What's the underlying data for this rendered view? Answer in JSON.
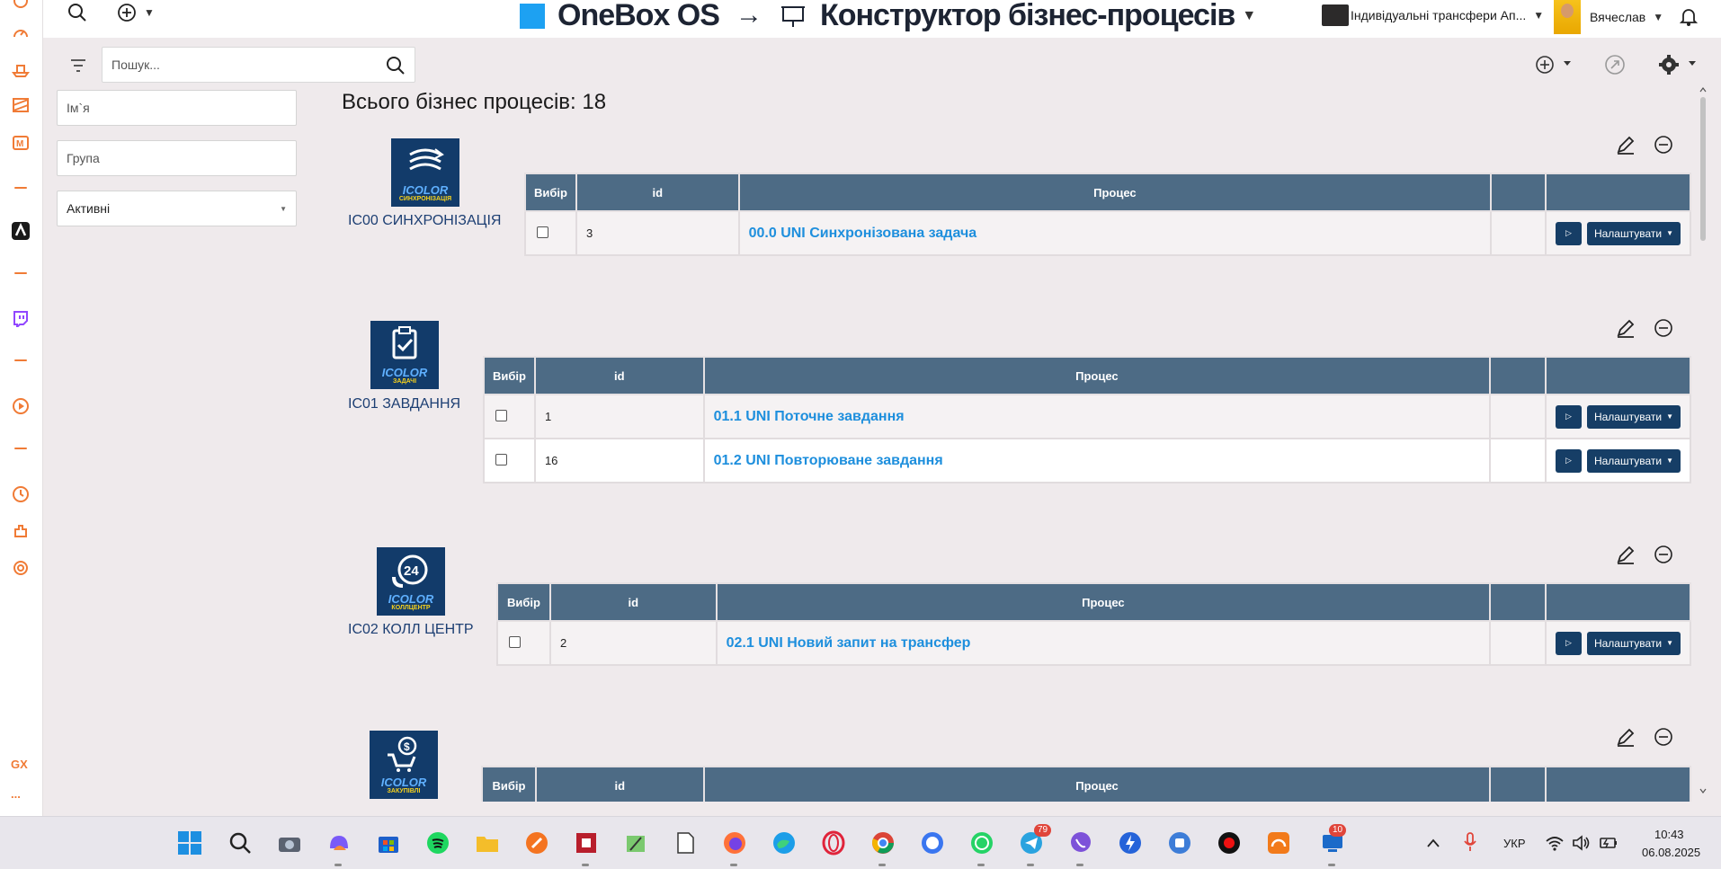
{
  "browser_sidebar": {
    "icons": [
      "home-icon",
      "speed-dial-icon",
      "boat-icon",
      "film-icon",
      "mail-icon",
      "app-icon",
      "twitch-icon",
      "player-icon",
      "history-icon",
      "extensions-icon",
      "settings-icon"
    ],
    "footer_label": "GX",
    "more_label": "..."
  },
  "header": {
    "brand": "OneBox OS",
    "arrow": "→",
    "title": "Конструктор бізнес-процесів",
    "company": "Індивідуальні трансфери Ап...",
    "user": "Вячеслав"
  },
  "toolbar": {
    "search_placeholder": "Пошук..."
  },
  "filters": {
    "name_placeholder": "Ім`я",
    "group_placeholder": "Група",
    "status_value": "Активні"
  },
  "summary": {
    "total": "Всього бізнес процесів: 18"
  },
  "table_headers": {
    "select": "Вибір",
    "id": "id",
    "process": "Процес"
  },
  "buttons": {
    "run": "▷",
    "configure": "Налаштувати"
  },
  "groups": [
    {
      "name": "IC00 СИНХРОНІЗАЦІЯ",
      "logo_brand": "ICOLOR",
      "logo_sub": "СИНХРОНІЗАЦІЯ",
      "rows": [
        {
          "id": "3",
          "process": "00.0 UNI Синхронізована задача"
        }
      ]
    },
    {
      "name": "IC01 ЗАВДАННЯ",
      "logo_brand": "ICOLOR",
      "logo_sub": "ЗАДАЧІ",
      "rows": [
        {
          "id": "1",
          "process": "01.1 UNI Поточне завдання"
        },
        {
          "id": "16",
          "process": "01.2 UNI Повторюване завдання"
        }
      ]
    },
    {
      "name": "IC02 КОЛЛ ЦЕНТР",
      "logo_brand": "ICOLOR",
      "logo_sub": "КОЛЛЦЕНТР",
      "rows": [
        {
          "id": "2",
          "process": "02.1 UNI Новий запит на трансфер"
        }
      ]
    },
    {
      "name": "",
      "logo_brand": "ICOLOR",
      "logo_sub": "ЗАКУПІВЛІ",
      "rows": []
    }
  ],
  "taskbar": {
    "apps": [
      "start-icon",
      "search-icon",
      "camera-icon",
      "copilot-icon",
      "store-icon",
      "spotify-icon",
      "file-explorer-icon",
      "pen-icon",
      "app-red-icon",
      "paint-icon",
      "notepad-icon",
      "firefox-icon",
      "edge-icon",
      "opera-icon",
      "chrome-icon",
      "signal-icon",
      "whatsapp-icon",
      "telegram-icon",
      "viber-icon",
      "bolt-icon",
      "app-blue-icon",
      "record-icon",
      "speedtest-icon",
      "remote-icon"
    ],
    "telegram_badge": "79",
    "remote_badge": "10",
    "language": "УКР",
    "time": "10:43",
    "date": "06.08.2025"
  }
}
